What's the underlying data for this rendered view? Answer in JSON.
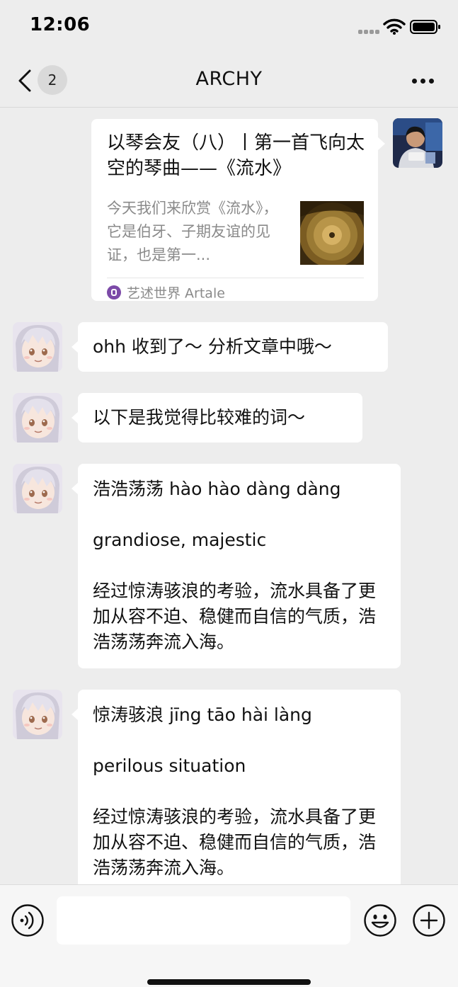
{
  "status_bar": {
    "time": "12:06",
    "signal_icon": "signal-icon",
    "wifi_icon": "wifi-icon",
    "battery_icon": "battery-icon"
  },
  "nav": {
    "back_icon": "chevron-left-icon",
    "unread_count": "2",
    "title": "ARCHY",
    "more_icon": "more-horizontal-icon"
  },
  "article_card": {
    "title": "以琴会友（八）丨第一首飞向太空的琴曲——《流水》",
    "description": "今天我们来欣赏《流水》，它是伯牙、子期友谊的见证，也是第一...",
    "source": "艺述世界 Artale",
    "source_icon": "artale-logo-icon",
    "thumbnail_icon": "record-disc-image"
  },
  "messages": [
    {
      "sender": "other",
      "text": "ohh 收到了～ 分析文章中哦～"
    },
    {
      "sender": "other",
      "text": "以下是我觉得比较难的词～"
    },
    {
      "sender": "other",
      "word": "浩浩荡荡 hào hào dàng dàng",
      "meaning": "grandiose, majestic",
      "example": "经过惊涛骇浪的考验，流水具备了更加从容不迫、稳健而自信的气质，浩浩荡荡奔流入海。"
    },
    {
      "sender": "other",
      "word": "惊涛骇浪 jīng tāo hài làng",
      "meaning": "perilous situation",
      "example": "经过惊涛骇浪的考验，流水具备了更加从容不迫、稳健而自信的气质，浩浩荡荡奔流入海。"
    }
  ],
  "input_bar": {
    "voice_icon": "voice-icon",
    "input_value": "",
    "emoji_icon": "emoji-icon",
    "add_icon": "plus-circle-icon"
  },
  "colors": {
    "background": "#ededed",
    "bubble": "#ffffff",
    "input_bar": "#f6f6f6"
  }
}
